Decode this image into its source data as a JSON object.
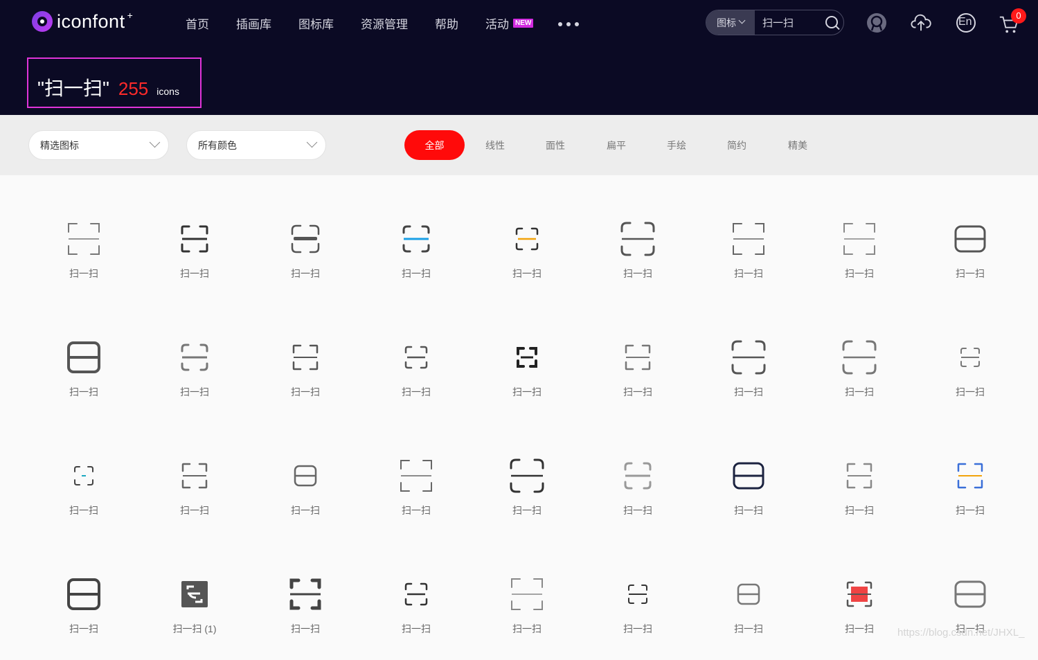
{
  "header": {
    "logo_text": "iconfont",
    "logo_plus": "+",
    "nav": [
      "首页",
      "插画库",
      "图标库",
      "资源管理",
      "帮助",
      "活动"
    ],
    "new_badge": "NEW",
    "search": {
      "type_label": "图标",
      "value": "扫一扫"
    },
    "cart_count": "0",
    "lang_label": "En"
  },
  "result": {
    "query": "\"扫一扫\"",
    "count": "255",
    "unit": "icons"
  },
  "filters": {
    "select1": "精选图标",
    "select2": "所有颜色",
    "chips": [
      "全部",
      "线性",
      "面性",
      "扁平",
      "手绘",
      "简约",
      "精美"
    ],
    "active_chip": "全部"
  },
  "colors": {
    "header_bg": "#0b0a24",
    "accent_red": "#ff0a0a",
    "highlight_box": "#e034d8"
  },
  "icons": [
    {
      "label": "扫一扫",
      "style": "corners-thin",
      "bar": "#777"
    },
    {
      "label": "扫一扫",
      "style": "corners-bold",
      "bar": "#333"
    },
    {
      "label": "扫一扫",
      "style": "rounded-heavybar",
      "bar": "#555"
    },
    {
      "label": "扫一扫",
      "style": "corners-round",
      "bar": "#1aa0e6",
      "corner": "#444"
    },
    {
      "label": "扫一扫",
      "style": "corners-round-small",
      "bar": "#f2a30b",
      "corner": "#333"
    },
    {
      "label": "扫一扫",
      "style": "wide-rounded",
      "bar": "#555"
    },
    {
      "label": "扫一扫",
      "style": "corners-thin",
      "bar": "#666"
    },
    {
      "label": "扫一扫",
      "style": "corners-thin",
      "bar": "#888"
    },
    {
      "label": "扫一扫",
      "style": "frame-split",
      "bar": "#555"
    },
    {
      "label": "扫一扫",
      "style": "frame-split-heavy",
      "bar": "#555"
    },
    {
      "label": "扫一扫",
      "style": "corners-round",
      "bar": "#777"
    },
    {
      "label": "扫一扫",
      "style": "corners-small",
      "bar": "#555"
    },
    {
      "label": "扫一扫",
      "style": "corners-round-small",
      "bar": "#555"
    },
    {
      "label": "扫一扫",
      "style": "bracket-dark",
      "bar": "#222"
    },
    {
      "label": "扫一扫",
      "style": "corners-small",
      "bar": "#777"
    },
    {
      "label": "扫一扫",
      "style": "wide-rounded",
      "bar": "#555"
    },
    {
      "label": "扫一扫",
      "style": "wide-rounded",
      "bar": "#777"
    },
    {
      "label": "扫一扫",
      "style": "corners-tiny",
      "bar": "#777"
    },
    {
      "label": "扫一扫",
      "style": "corners-tiny",
      "bar": "#1aa8c0",
      "corner": "#444"
    },
    {
      "label": "扫一扫",
      "style": "corners-small",
      "bar": "#666"
    },
    {
      "label": "扫一扫",
      "style": "frame-split-small",
      "bar": "#666"
    },
    {
      "label": "扫一扫",
      "style": "corners-thin",
      "bar": "#666"
    },
    {
      "label": "扫一扫",
      "style": "wide-rounded",
      "bar": "#333"
    },
    {
      "label": "扫一扫",
      "style": "corners-round",
      "bar": "#999"
    },
    {
      "label": "扫一扫",
      "style": "frame-split",
      "bar": "#1c2340"
    },
    {
      "label": "扫一扫",
      "style": "corners-small",
      "bar": "#888"
    },
    {
      "label": "扫一扫",
      "style": "corners-small",
      "bar": "#f2a30b",
      "corner": "#3a6fd8"
    },
    {
      "label": "扫一扫",
      "style": "frame-split-heavy",
      "bar": "#444"
    },
    {
      "label": "扫一扫 (1)",
      "style": "filled-square",
      "bar": "#555"
    },
    {
      "label": "扫一扫",
      "style": "block-corners",
      "bar": "#444"
    },
    {
      "label": "扫一扫",
      "style": "corners-round-small",
      "bar": "#333"
    },
    {
      "label": "扫一扫",
      "style": "corners-thin",
      "bar": "#888"
    },
    {
      "label": "扫一扫",
      "style": "corners-tiny",
      "bar": "#333"
    },
    {
      "label": "扫一扫",
      "style": "frame-split-small",
      "bar": "#777"
    },
    {
      "label": "扫一扫",
      "style": "red-square",
      "bar": "#ef4444"
    },
    {
      "label": "扫一扫",
      "style": "frame-split",
      "bar": "#777"
    }
  ],
  "watermark": "https://blog.csdn.net/JHXL_"
}
